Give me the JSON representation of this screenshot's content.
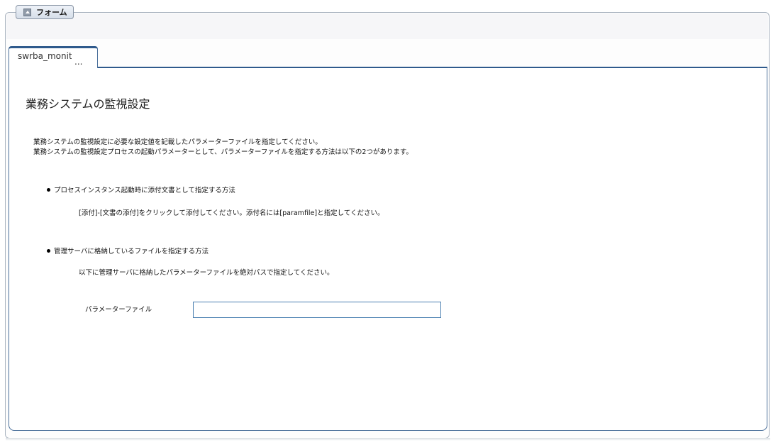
{
  "legend": {
    "label": "フォーム",
    "icon": "up-arrow-icon"
  },
  "tabs": [
    {
      "label": "swrba_monitor",
      "overflow": "..."
    }
  ],
  "main": {
    "title": "業務システムの監視設定",
    "intro_line1": "業務システムの監視設定に必要な設定値を記載したパラメーターファイルを指定してください。",
    "intro_line2": "業務システムの監視設定プロセスの起動パラメーターとして、パラメーターファイルを指定する方法は以下の2つがあります。",
    "method1": {
      "heading": "プロセスインスタンス起動時に添付文書として指定する方法",
      "desc": "[添付]-[文書の添付]をクリックして添付してください。添付名には[paramfile]と指定してください。"
    },
    "method2": {
      "heading": "管理サーバに格納しているファイルを指定する方法",
      "desc": "以下に管理サーバに格納したパラメーターファイルを絶対パスで指定してください。"
    },
    "param_field": {
      "label": "パラメーターファイル",
      "value": "",
      "placeholder": ""
    }
  }
}
